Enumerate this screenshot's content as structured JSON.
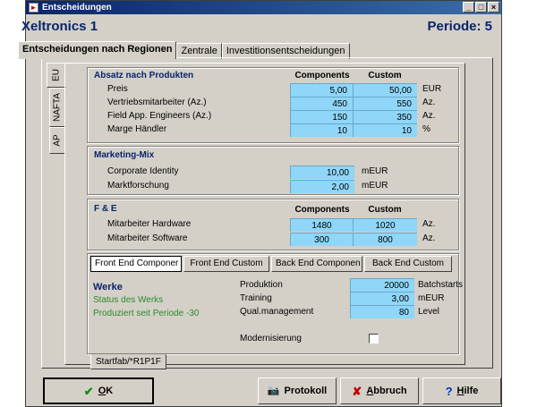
{
  "window": {
    "title": "Entscheidungen",
    "minimize": "_",
    "maximize": "□",
    "close": "×"
  },
  "header": {
    "company": "Xeltronics 1",
    "period": "Periode: 5"
  },
  "main_tabs": [
    {
      "label": "Entscheidungen nach Regionen"
    },
    {
      "label": "Zentrale"
    },
    {
      "label": "Investitionsentscheidungen"
    }
  ],
  "region_tabs": [
    {
      "label": "EU"
    },
    {
      "label": "NAFTA"
    },
    {
      "label": "AP"
    }
  ],
  "absatz": {
    "title": "Absatz nach Produkten",
    "columns": [
      "Components",
      "Custom"
    ],
    "rows": [
      {
        "label": "Preis",
        "c1": "5,00",
        "c2": "50,00",
        "unit": "EUR"
      },
      {
        "label": "Vertriebsmitarbeiter (Az.)",
        "c1": "450",
        "c2": "550",
        "unit": "Az."
      },
      {
        "label": "Field App. Engineers (Az.)",
        "c1": "150",
        "c2": "350",
        "unit": "Az."
      },
      {
        "label": "Marge Händler",
        "c1": "10",
        "c2": "10",
        "unit": "%"
      }
    ]
  },
  "marketing": {
    "title": "Marketing-Mix",
    "rows": [
      {
        "label": "Corporate Identity",
        "value": "10,00",
        "unit": "mEUR"
      },
      {
        "label": "Marktforschung",
        "value": "2,00",
        "unit": "mEUR"
      }
    ]
  },
  "fe": {
    "title": "F & E",
    "columns": [
      "Components",
      "Custom"
    ],
    "rows": [
      {
        "label": "Mitarbeiter Hardware",
        "c1": "1480",
        "c2": "1020",
        "unit": "Az."
      },
      {
        "label": "Mitarbeiter Software",
        "c1": "300",
        "c2": "800",
        "unit": "Az."
      }
    ]
  },
  "sub_tabs": [
    {
      "label": "Front End Componer"
    },
    {
      "label": "Front End Custom"
    },
    {
      "label": "Back End Componen"
    },
    {
      "label": "Back End Custom"
    }
  ],
  "werke": {
    "title": "Werke",
    "status": "Status des Werks",
    "since": "Produziert seit Periode -30",
    "rows": [
      {
        "label": "Produktion",
        "value": "20000",
        "unit": "Batchstarts"
      },
      {
        "label": "Training",
        "value": "3,00",
        "unit": "mEUR"
      },
      {
        "label": "Qual.management",
        "value": "80",
        "unit": "Level"
      }
    ],
    "modernisierung": "Modernisierung"
  },
  "bottom_tab": "Startfab/*R1P1F",
  "buttons": {
    "ok": {
      "underline": "O",
      "rest": "K",
      "icon": "✔"
    },
    "protokoll": {
      "label": "Protokoll",
      "icon": "📷"
    },
    "abbruch": {
      "underline": "A",
      "rest": "bbruch",
      "icon": "✘"
    },
    "hilfe": {
      "underline": "H",
      "rest": "ilfe",
      "icon": "?"
    }
  },
  "colors": {
    "input_bg": "#8fd6f8",
    "heading": "#0a246a",
    "status_green": "#2a8a2a"
  }
}
